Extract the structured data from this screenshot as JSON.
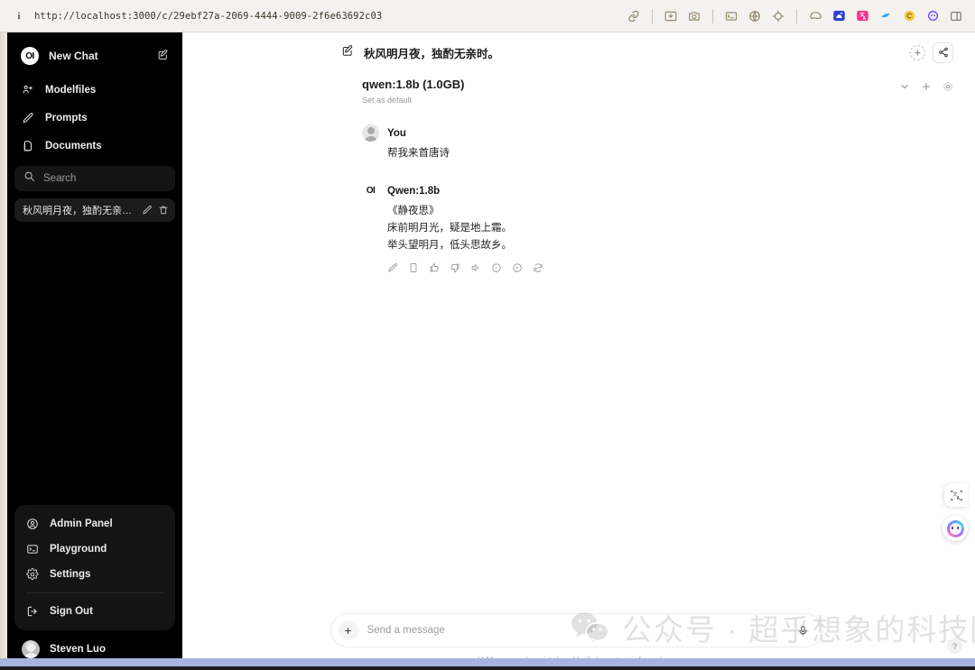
{
  "browser": {
    "url": "http://localhost:3000/c/29ebf27a-2069-4444-9009-2f6e63692c03",
    "info_glyph": "i",
    "toolbar_icons": [
      {
        "name": "link-icon"
      },
      {
        "name": "download-image-icon"
      },
      {
        "name": "screenshot-camera-icon"
      },
      {
        "name": "window-terminal-icon"
      },
      {
        "name": "globe-icon"
      },
      {
        "name": "target-crosshair-icon"
      },
      {
        "name": "ghost-extension-icon"
      },
      {
        "name": "blue-app-icon"
      },
      {
        "name": "pink-translate-icon"
      },
      {
        "name": "blue-bird-icon"
      },
      {
        "name": "yellow-circle-icon"
      },
      {
        "name": "purple-face-icon"
      },
      {
        "name": "sidebar-panel-icon"
      }
    ]
  },
  "sidebar": {
    "logo_text": "OI",
    "new_chat_label": "New Chat",
    "nav_items": [
      {
        "label": "Modelfiles",
        "icon": "models-icon"
      },
      {
        "label": "Prompts",
        "icon": "pencil-icon"
      },
      {
        "label": "Documents",
        "icon": "documents-icon"
      }
    ],
    "search": {
      "placeholder": "Search"
    },
    "chats": [
      {
        "title": "秋风明月夜，独酌无亲时。"
      }
    ],
    "menu_items": [
      {
        "label": "Admin Panel",
        "icon": "user-circle-icon"
      },
      {
        "label": "Playground",
        "icon": "terminal-icon"
      },
      {
        "label": "Settings",
        "icon": "gear-icon"
      }
    ],
    "sign_out_label": "Sign Out",
    "user_name": "Steven Luo"
  },
  "chat": {
    "title": "秋风明月夜，独酌无亲时。",
    "model_name": "qwen:1.8b (1.0GB)",
    "set_as_default": "Set as default",
    "messages": [
      {
        "role": "user",
        "name": "You",
        "lines": [
          "帮我来首唐诗"
        ]
      },
      {
        "role": "assistant",
        "name": "Qwen:1.8b",
        "avatar_text": "OI",
        "lines": [
          "《静夜思》",
          "床前明月光，疑是地上霜。",
          "举头望明月，低头思故乡。"
        ],
        "actions": [
          {
            "name": "edit-icon"
          },
          {
            "name": "copy-icon"
          },
          {
            "name": "thumbs-up-icon"
          },
          {
            "name": "thumbs-down-icon"
          },
          {
            "name": "speaker-icon"
          },
          {
            "name": "info-icon"
          },
          {
            "name": "play-circle-icon"
          },
          {
            "name": "regenerate-icon"
          }
        ]
      }
    ]
  },
  "composer": {
    "placeholder": "Send a message",
    "plus_label": "+",
    "disclaimer": "LLMs can make mistakes. Verify important information."
  },
  "overlay": {
    "watermark_text": "公众号 · 超乎想象的科技圈",
    "help_label": "?"
  },
  "colors": {
    "sidebar_bg": "#000000",
    "main_bg": "#ffffff",
    "browser_chrome_bg": "#f4f2ee",
    "bottom_strip": "#a8b4e0",
    "accent_text": "#1d1d1d"
  }
}
